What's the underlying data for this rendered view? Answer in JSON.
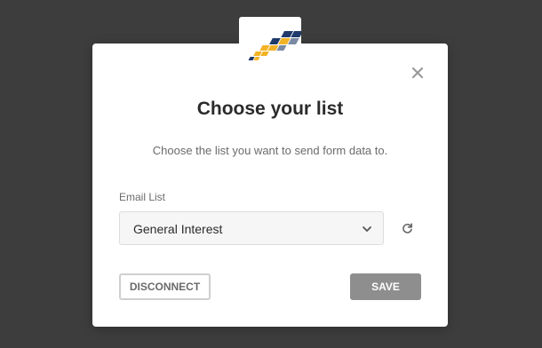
{
  "modal": {
    "title": "Choose your list",
    "subtitle": "Choose the list you want to send form data to.",
    "close_icon": "close-icon",
    "logo_icon": "logo-icon"
  },
  "email_list": {
    "label": "Email List",
    "selected": "General Interest",
    "chevron_icon": "chevron-down-icon",
    "refresh_icon": "refresh-icon"
  },
  "actions": {
    "disconnect_label": "DISCONNECT",
    "save_label": "SAVE"
  },
  "colors": {
    "overlay": "#3d3d3d",
    "logo_navy": "#1f3a6b",
    "logo_gold": "#f2b325",
    "logo_slate": "#7b8aa3",
    "save_button": "#8e8e8e"
  }
}
